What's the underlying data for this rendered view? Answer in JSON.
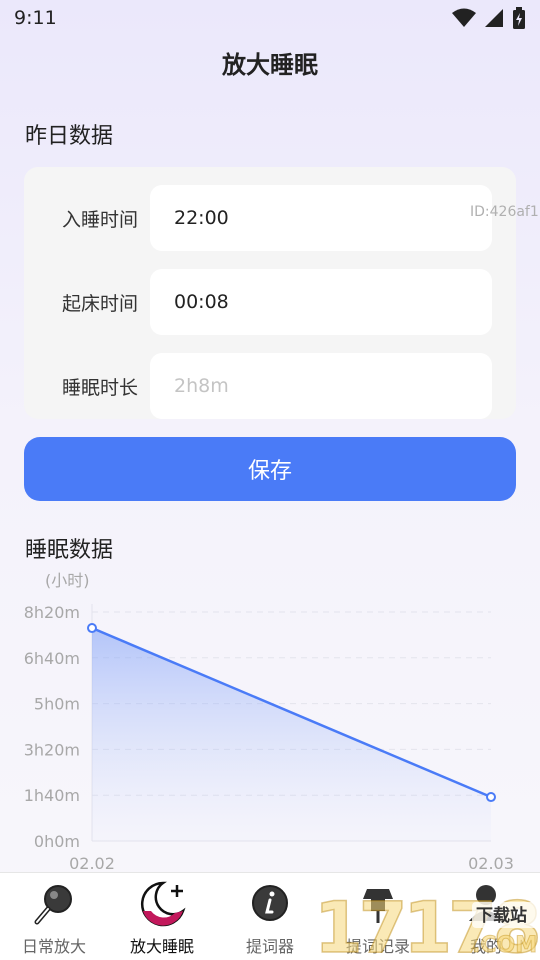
{
  "status": {
    "time": "9:11"
  },
  "header": {
    "title": "放大睡眠"
  },
  "yesterday": {
    "title": "昨日数据",
    "rows": [
      {
        "label": "入睡时间",
        "value": "22:00",
        "placeholder": ""
      },
      {
        "label": "起床时间",
        "value": "00:08",
        "placeholder": ""
      },
      {
        "label": "睡眠时长",
        "value": "",
        "placeholder": "2h8m"
      }
    ],
    "id_tag": "ID:426af1",
    "save_label": "保存"
  },
  "sleep_section": {
    "title": "睡眠数据"
  },
  "chart_data": {
    "type": "area",
    "ylabel": "(小时)",
    "x": [
      "02.02",
      "02.03"
    ],
    "values": [
      7.75,
      1.6
    ],
    "yticks": [
      {
        "value": 0,
        "label": "0h0m"
      },
      {
        "value": 1.6667,
        "label": "1h40m"
      },
      {
        "value": 3.3333,
        "label": "3h20m"
      },
      {
        "value": 5,
        "label": "5h0m"
      },
      {
        "value": 6.6667,
        "label": "6h40m"
      },
      {
        "value": 8.3333,
        "label": "8h20m"
      }
    ],
    "ylim": [
      0,
      8.3333
    ],
    "grid": true,
    "line_color": "#4a7bf7"
  },
  "tabs": [
    {
      "label": "日常放大",
      "icon": "magnifier-icon",
      "active": false
    },
    {
      "label": "放大睡眠",
      "icon": "moon-icon",
      "active": true
    },
    {
      "label": "提词器",
      "icon": "info-icon",
      "active": false
    },
    {
      "label": "提词记录",
      "icon": "record-icon",
      "active": false
    },
    {
      "label": "我的",
      "icon": "user-icon",
      "active": false
    }
  ],
  "watermark": {
    "digits": "17178",
    "badge": "下载站",
    "suffix": ".COM"
  }
}
